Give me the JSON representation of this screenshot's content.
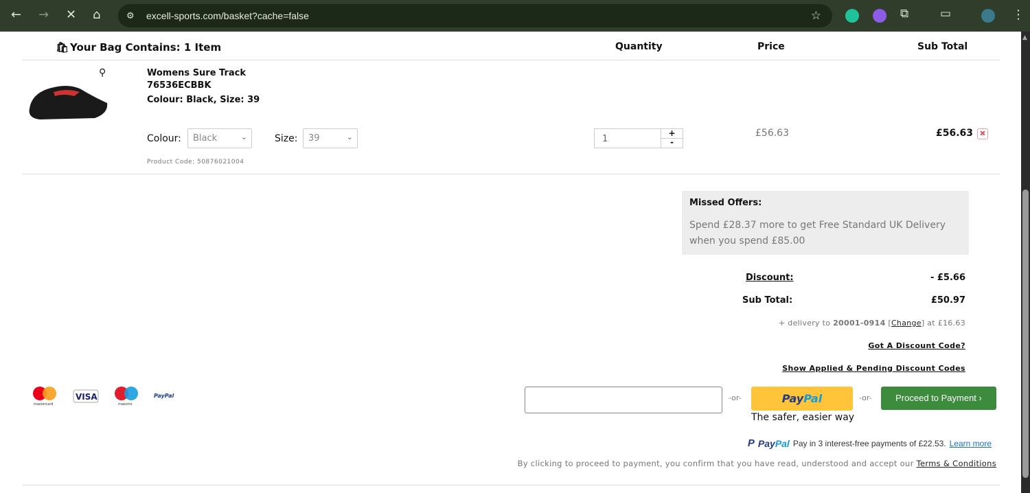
{
  "browser": {
    "url": "excell-sports.com/basket?cache=false"
  },
  "basket": {
    "title": "Your Bag Contains: 1 Item",
    "headers": {
      "quantity": "Quantity",
      "price": "Price",
      "subtotal": "Sub Total"
    },
    "item": {
      "name": "Womens Sure Track",
      "code": "76536ECBBK",
      "variant": "Colour: Black, Size: 39",
      "colour_label": "Colour:",
      "colour_value": "Black",
      "size_label": "Size:",
      "size_value": "39",
      "product_code": "Product Code: 50876021004",
      "quantity": "1",
      "plus": "+",
      "minus": "-",
      "price": "£56.63",
      "subtotal": "£56.63"
    }
  },
  "missed": {
    "title": "Missed Offers:",
    "text": "Spend £28.37 more to get Free Standard UK Delivery when you spend £85.00"
  },
  "totals": {
    "discount_label": "Discount:",
    "discount_value": "- £5.66",
    "subtotal_label": "Sub Total:",
    "subtotal_value": "£50.97",
    "delivery_prefix": "+ delivery to ",
    "postcode": "20001-0914",
    "bracket_open": " [",
    "change": "Change",
    "delivery_suffix": "] at £16.63",
    "discount_link": "Got A Discount Code?",
    "applied_link": "Show Applied & Pending Discount Codes"
  },
  "payment": {
    "or1": "-or-",
    "or2": "-or-",
    "paypal_pay": "Pay",
    "paypal_pal": "Pal",
    "paypal_tagline": "The safer, easier way",
    "proceed": "Proceed to Payment ›",
    "paylater_text": "Pay in 3 interest-free payments of £22.53.",
    "learn_more": "Learn more",
    "terms_text": "By clicking to proceed to payment, you confirm that you have read, understood and accept our ",
    "terms_link": "Terms & Conditions",
    "logos": {
      "mastercard": "mastercard",
      "visa": "VISA",
      "maestro": "maestro",
      "paypal": "PayPal"
    }
  },
  "colors": {
    "green": "#3d8b3d",
    "paypal_yellow": "#ffc439",
    "chrome": "#2f3d2a"
  }
}
